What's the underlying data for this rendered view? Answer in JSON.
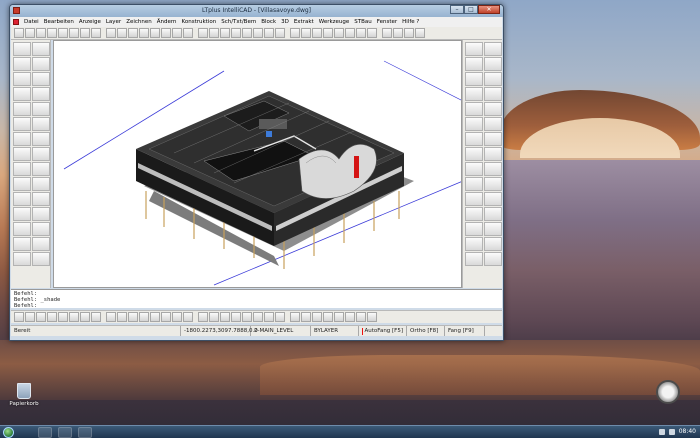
{
  "window": {
    "title": "LTplus IntelliCAD - [Villasavoye.dwg]",
    "controls": {
      "minimize": "–",
      "maximize": "□",
      "close": "✕"
    }
  },
  "menu": [
    "Datei",
    "Bearbeiten",
    "Anzeige",
    "Layer",
    "Zeichnen",
    "Ändern",
    "Konstruktion",
    "Sch/Txt/Bem",
    "Block",
    "3D",
    "Extrakt",
    "Werkzeuge",
    "STBau",
    "Fenster",
    "Hilfe ?"
  ],
  "toolbar_top_count": 40,
  "toolbar_bottom_count": 34,
  "left_tools_count": 30,
  "right_tools_count": 30,
  "command_line": {
    "line1": "Befehl:",
    "line2": "Befehl: _shade",
    "line3": "Befehl:"
  },
  "status": {
    "ready": "Bereit",
    "coords": "-1800.2273,3097.7888,0.0",
    "layer": "2-MAIN_LEVEL",
    "linetype": "BYLAYER",
    "autofang": "AutoFang [F5]",
    "ortho": "Ortho [F8]",
    "fang": "Fang [F9]"
  },
  "desktop": {
    "recycle_bin": "Papierkorb"
  },
  "taskbar": {
    "clock": "08:40"
  }
}
